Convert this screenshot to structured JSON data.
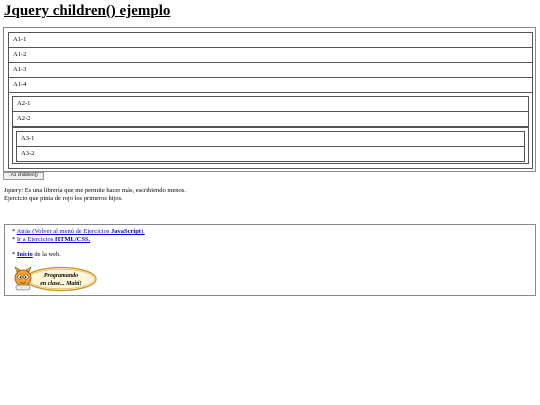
{
  "page": {
    "title": "Jquery children() ejemplo"
  },
  "tree": {
    "level1": [
      "A1-1",
      "A1-2",
      "A1-3",
      "A1-4"
    ],
    "level2": [
      "A2-1",
      "A2-2"
    ],
    "level3": [
      "A3-1",
      "A3-2"
    ]
  },
  "button": {
    "label": ".A1 children()"
  },
  "description": {
    "line1": "Jquery: Es una librería que me permite hacer más, escribiendo menos.",
    "line2": "Ejercicio que pinta de rojo los primeros hijos."
  },
  "links": {
    "back_prefix": "* ",
    "back_text": "Atrás (Volver al menú de Ejercicios ",
    "back_bold": "JavaScript",
    "back_suffix": ").",
    "exercises_prefix": "* ",
    "exercises_text": "Ir a Ejercicios ",
    "exercises_bold": "HTML/CSS.",
    "home_prefix": "* ",
    "home_bold": "Inicio",
    "home_text": " de la web."
  },
  "logo": {
    "line1": "Programando",
    "line2": "en clase... Maití!"
  }
}
